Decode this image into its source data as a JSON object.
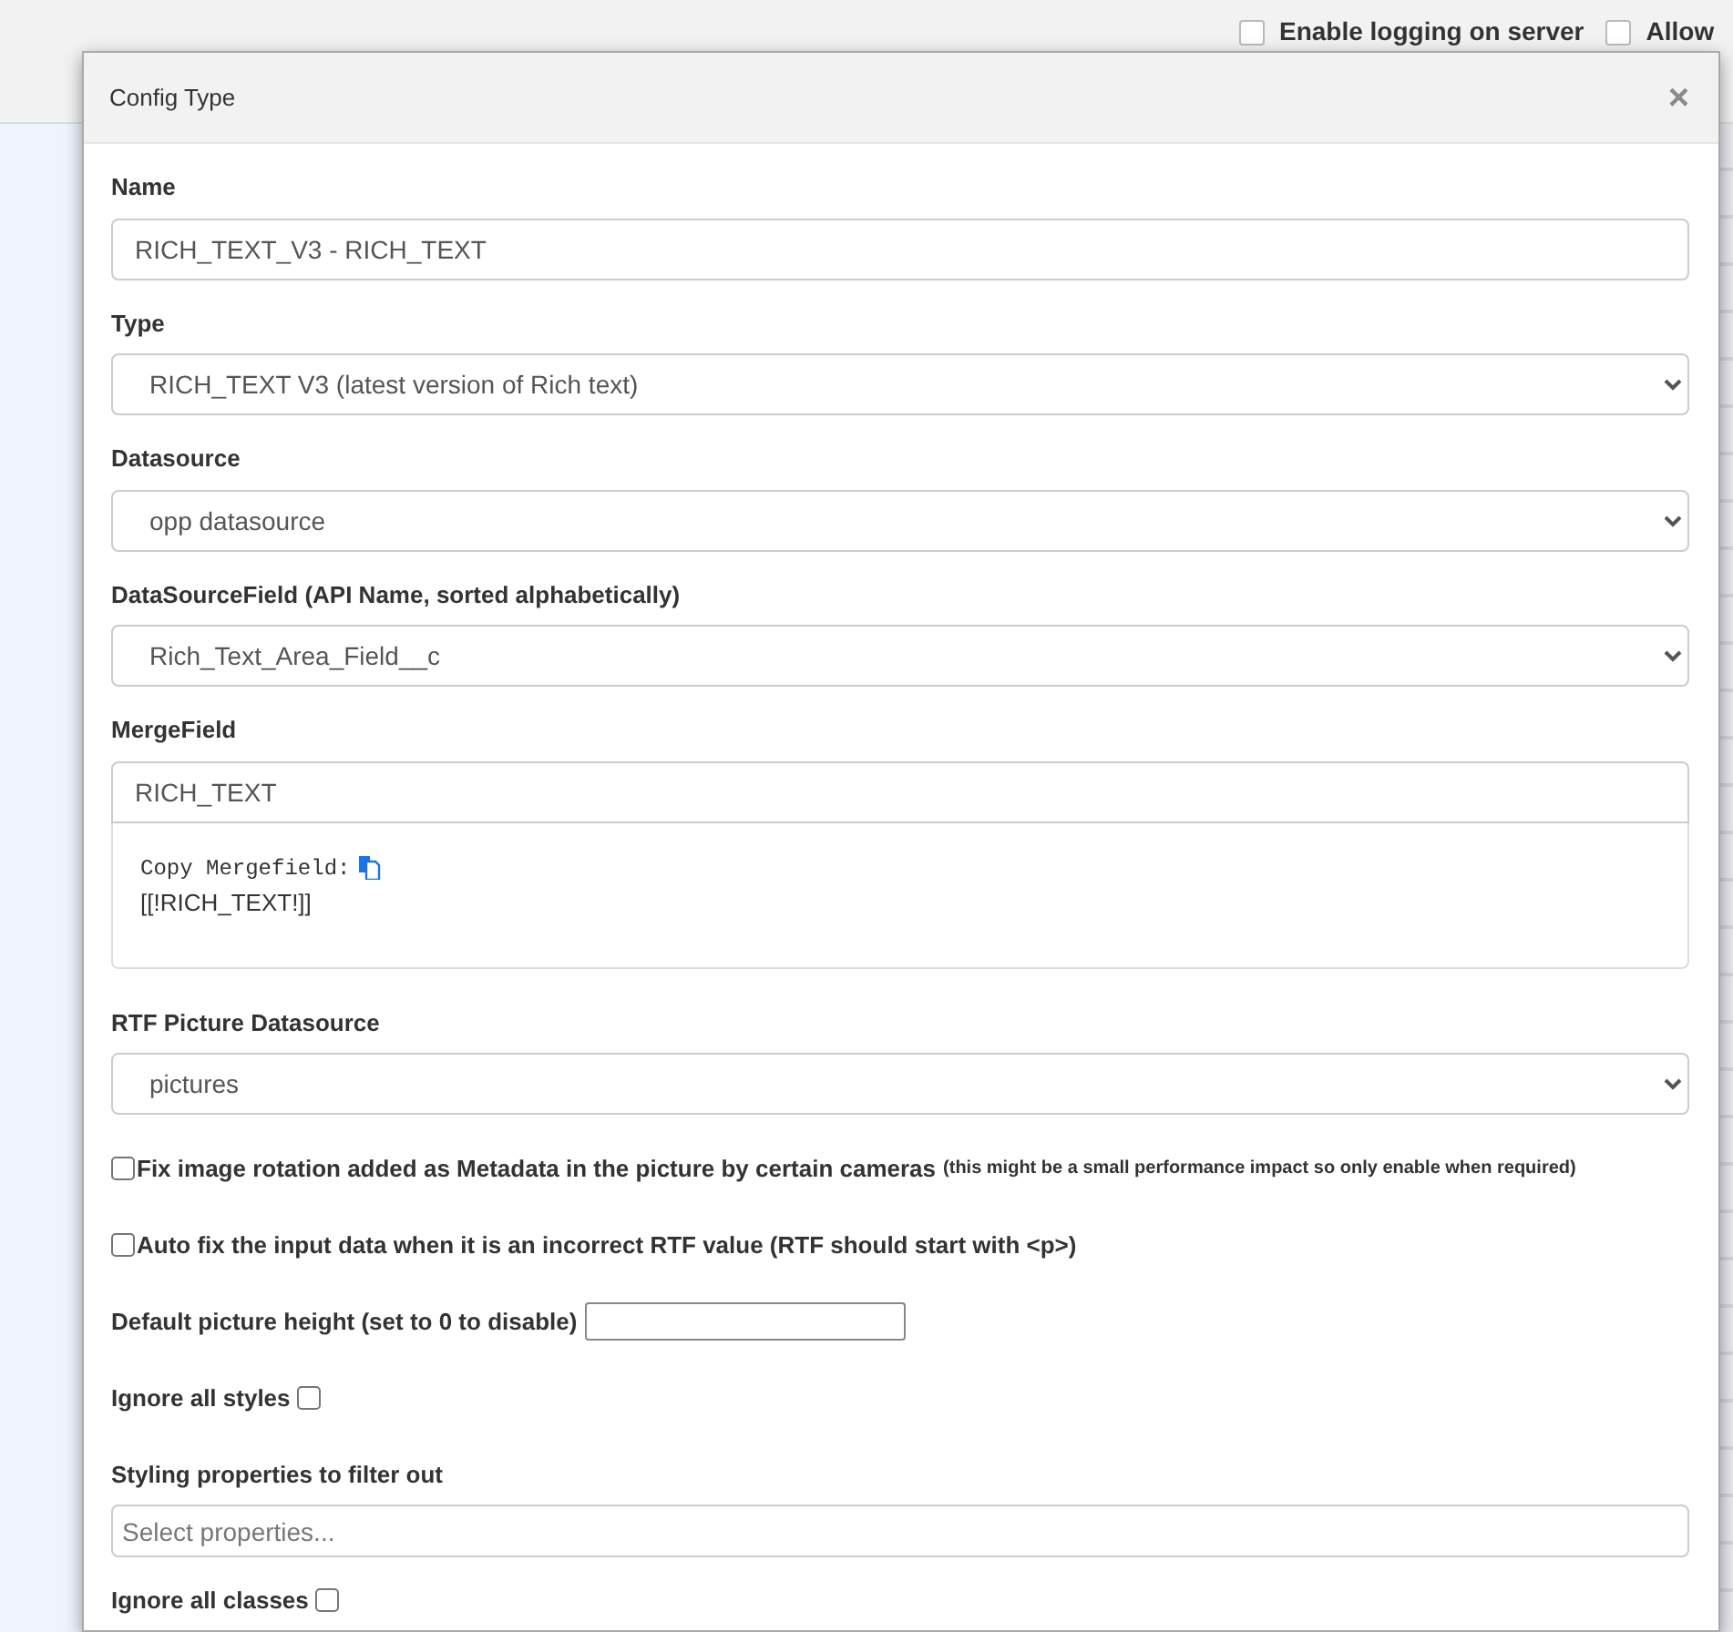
{
  "background": {
    "options": [
      {
        "label": "Enable logging on server",
        "checked": false
      },
      {
        "label": "Allow",
        "checked": false
      }
    ]
  },
  "modal": {
    "title": "Config Type",
    "close": "×",
    "fields": [
      {
        "kind": "text",
        "label": "Name",
        "value": "RICH_TEXT_V3 - RICH_TEXT"
      },
      {
        "kind": "select",
        "label": "Type",
        "value": "RICH_TEXT V3 (latest version of Rich text)"
      },
      {
        "kind": "select",
        "label": "Datasource",
        "value": "opp datasource"
      },
      {
        "kind": "select",
        "label": "DataSourceField (API Name, sorted alphabetically)",
        "value": "Rich_Text_Area_Field__c"
      },
      {
        "kind": "merge",
        "label": "MergeField",
        "value": "RICH_TEXT",
        "copy_label": "Copy Mergefield:",
        "merge_code": "[[!RICH_TEXT!]]"
      },
      {
        "kind": "select",
        "label": "RTF Picture Datasource",
        "value": "pictures"
      },
      {
        "kind": "check-before",
        "label": "Fix image rotation added as Metadata in the picture by certain cameras",
        "note": "(this might be a small performance impact so only enable when required)",
        "checked": false
      },
      {
        "kind": "check-before",
        "label": "Auto fix the input data when it is an incorrect RTF value (RTF should start with <p>)",
        "checked": false
      },
      {
        "kind": "inline-input",
        "label": "Default picture height (set to 0 to disable)"
      },
      {
        "kind": "check-after",
        "label": "Ignore all styles",
        "checked": false
      },
      {
        "kind": "multi",
        "label": "Styling properties to filter out",
        "placeholder": "Select properties..."
      },
      {
        "kind": "check-after",
        "label": "Ignore all classes",
        "checked": false
      }
    ]
  }
}
